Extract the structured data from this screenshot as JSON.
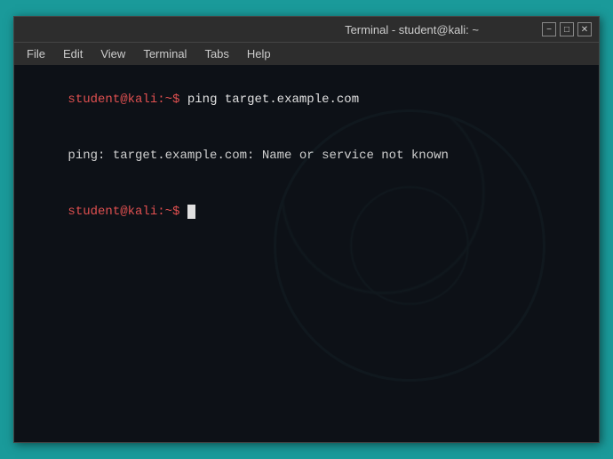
{
  "window": {
    "title": "Terminal - student@kali: ~",
    "minimize_label": "−",
    "maximize_label": "□",
    "close_label": "✕"
  },
  "menubar": {
    "items": [
      "File",
      "Edit",
      "View",
      "Terminal",
      "Tabs",
      "Help"
    ]
  },
  "terminal": {
    "line1_prompt": "student@kali",
    "line1_separator": ":~$",
    "line1_command": " ping target.example.com",
    "line2_output": "ping: target.example.com: Name or service not known",
    "line3_prompt": "student@kali",
    "line3_separator": ":~$"
  }
}
